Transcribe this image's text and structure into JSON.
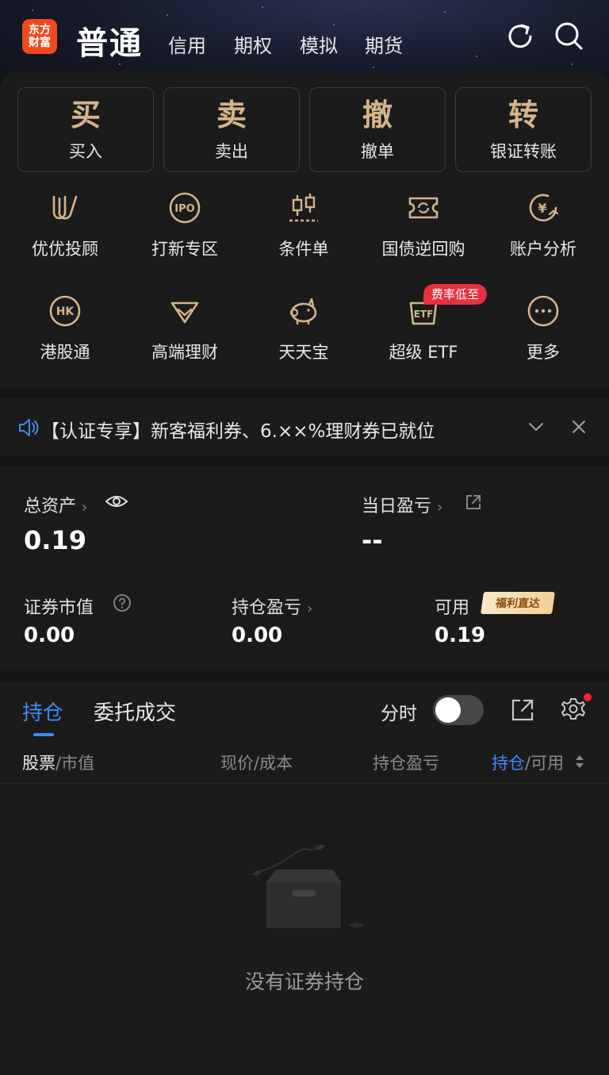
{
  "header": {
    "logo_line1": "东方",
    "logo_line2": "财富",
    "title": "普通",
    "tabs": [
      "信用",
      "期权",
      "模拟",
      "期货"
    ]
  },
  "trade_buttons": [
    {
      "big": "买",
      "label": "买入"
    },
    {
      "big": "卖",
      "label": "卖出"
    },
    {
      "big": "撤",
      "label": "撤单"
    },
    {
      "big": "转",
      "label": "银证转账"
    }
  ],
  "grid_row1": [
    {
      "icon": "youyou-icon",
      "label": "优优投顾"
    },
    {
      "icon": "ipo-icon",
      "icon_text": "IPO",
      "label": "打新专区"
    },
    {
      "icon": "candlestick-icon",
      "label": "条件单"
    },
    {
      "icon": "bond-repo-icon",
      "label": "国债逆回购"
    },
    {
      "icon": "account-analysis-icon",
      "icon_text": "¥",
      "label": "账户分析"
    }
  ],
  "grid_row2": [
    {
      "icon": "hk-icon",
      "icon_text": "HK",
      "label": "港股通"
    },
    {
      "icon": "diamond-icon",
      "label": "高端理财"
    },
    {
      "icon": "piggy-bank-icon",
      "label": "天天宝"
    },
    {
      "icon": "etf-icon",
      "icon_text": "ETF",
      "label": "超级 ETF"
    },
    {
      "icon": "more-icon",
      "label": "更多"
    }
  ],
  "promo_badge": "费率低至",
  "notice": {
    "text": "【认证专享】新客福利券、6.××%理财券已就位"
  },
  "assets": {
    "total_label": "总资产",
    "total_value": "0.19",
    "daily_pl_label": "当日盈亏",
    "daily_pl_value": "--",
    "market_value_label": "证券市值",
    "market_value": "0.00",
    "position_pl_label": "持仓盈亏",
    "position_pl": "0.00",
    "available_label": "可用",
    "available_value": "0.19",
    "welfare_badge": "福利直达"
  },
  "positions": {
    "tab_active": "持仓",
    "tab_inactive": "委托成交",
    "timeshare_label": "分时",
    "col_stock": "股票",
    "col_stock_sub": "/市值",
    "col_price": "现价/成本",
    "col_pl": "持仓盈亏",
    "col_hold": "持仓",
    "col_hold_sub": "/可用",
    "empty_text": "没有证券持仓"
  },
  "colors": {
    "accent_blue": "#3f8bf0",
    "gold": "#d5b48a",
    "brand_orange": "#ee4a1e",
    "badge_red": "#e5323f"
  }
}
